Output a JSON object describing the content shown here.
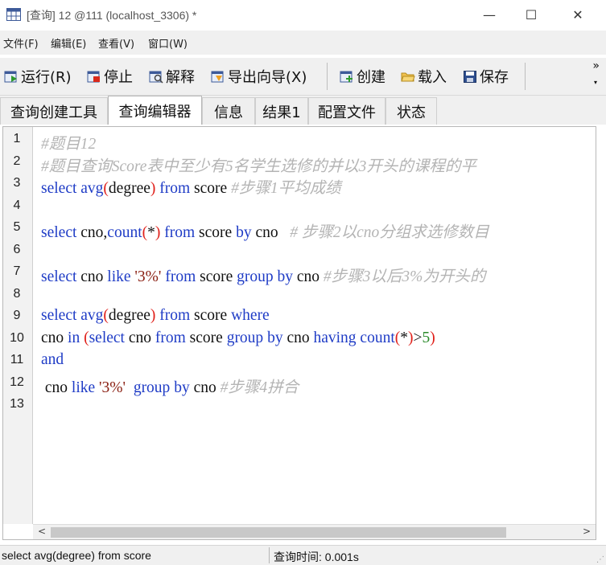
{
  "window": {
    "title": "[查询] 12 @111 (localhost_3306) *",
    "app_icon": "table-grid-icon",
    "controls": {
      "minimize": "—",
      "maximize": "☐",
      "close": "✕"
    }
  },
  "menu": {
    "items": [
      {
        "label": "文件(F)"
      },
      {
        "label": "编辑(E)"
      },
      {
        "label": "查看(V)"
      },
      {
        "label": "窗口(W)"
      }
    ]
  },
  "toolbar": {
    "run": {
      "label": "运行(R)",
      "icon": "run-icon"
    },
    "stop": {
      "label": "停止",
      "icon": "stop-icon"
    },
    "explain": {
      "label": "解释",
      "icon": "explain-icon"
    },
    "export": {
      "label": "导出向导(X)",
      "icon": "export-wizard-icon"
    },
    "create": {
      "label": "创建",
      "icon": "create-icon"
    },
    "load": {
      "label": "载入",
      "icon": "folder-open-icon"
    },
    "save": {
      "label": "保存",
      "icon": "save-icon"
    },
    "more": "»",
    "more_dropdown": "▾"
  },
  "tabs": [
    {
      "label": "查询创建工具"
    },
    {
      "label": "查询编辑器"
    },
    {
      "label": "信息"
    },
    {
      "label": "结果1"
    },
    {
      "label": "配置文件"
    },
    {
      "label": "状态"
    }
  ],
  "active_tab": "查询编辑器",
  "editor": {
    "line_numbers": [
      "1",
      "2",
      "3",
      "4",
      "5",
      "6",
      "7",
      "8",
      "9",
      "10",
      "11",
      "12",
      "13"
    ],
    "lines": [
      [
        {
          "t": "#题目12",
          "c": "cmt"
        }
      ],
      [
        {
          "t": "#题目查询Score表中至少有5名学生选修的并以3开头的课程的平",
          "c": "cmt"
        }
      ],
      [
        {
          "t": "select",
          "c": "kw"
        },
        {
          "t": " "
        },
        {
          "t": "avg",
          "c": "fn"
        },
        {
          "t": "(",
          "c": "par"
        },
        {
          "t": "degree"
        },
        {
          "t": ")",
          "c": "par"
        },
        {
          "t": " "
        },
        {
          "t": "from",
          "c": "kw"
        },
        {
          "t": " score "
        },
        {
          "t": "#步骤1平均成绩",
          "c": "cmt"
        }
      ],
      [],
      [
        {
          "t": "select",
          "c": "kw"
        },
        {
          "t": " cno,"
        },
        {
          "t": "count",
          "c": "fn"
        },
        {
          "t": "(",
          "c": "par"
        },
        {
          "t": "*"
        },
        {
          "t": ")",
          "c": "par"
        },
        {
          "t": " "
        },
        {
          "t": "from",
          "c": "kw"
        },
        {
          "t": " score "
        },
        {
          "t": "by",
          "c": "kw"
        },
        {
          "t": " cno   "
        },
        {
          "t": "# 步骤2以cno分组求选修数目",
          "c": "cmt"
        }
      ],
      [],
      [
        {
          "t": "select",
          "c": "kw"
        },
        {
          "t": " cno "
        },
        {
          "t": "like",
          "c": "kw"
        },
        {
          "t": " "
        },
        {
          "t": "'3%'",
          "c": "str"
        },
        {
          "t": " "
        },
        {
          "t": "from",
          "c": "kw"
        },
        {
          "t": " score "
        },
        {
          "t": "group",
          "c": "kw"
        },
        {
          "t": " "
        },
        {
          "t": "by",
          "c": "kw"
        },
        {
          "t": " cno "
        },
        {
          "t": "#步骤3以后3%为开头的",
          "c": "cmt"
        }
      ],
      [],
      [
        {
          "t": "select",
          "c": "kw"
        },
        {
          "t": " "
        },
        {
          "t": "avg",
          "c": "fn"
        },
        {
          "t": "(",
          "c": "par"
        },
        {
          "t": "degree"
        },
        {
          "t": ")",
          "c": "par"
        },
        {
          "t": " "
        },
        {
          "t": "from",
          "c": "kw"
        },
        {
          "t": " score "
        },
        {
          "t": "where",
          "c": "kw"
        }
      ],
      [
        {
          "t": "cno "
        },
        {
          "t": "in",
          "c": "kw"
        },
        {
          "t": " "
        },
        {
          "t": "(",
          "c": "par"
        },
        {
          "t": "select",
          "c": "kw"
        },
        {
          "t": " cno "
        },
        {
          "t": "from",
          "c": "kw"
        },
        {
          "t": " score "
        },
        {
          "t": "group",
          "c": "kw"
        },
        {
          "t": " "
        },
        {
          "t": "by",
          "c": "kw"
        },
        {
          "t": " cno "
        },
        {
          "t": "having",
          "c": "kw"
        },
        {
          "t": " "
        },
        {
          "t": "count",
          "c": "fn"
        },
        {
          "t": "(",
          "c": "par"
        },
        {
          "t": "*"
        },
        {
          "t": ")",
          "c": "par"
        },
        {
          "t": ">"
        },
        {
          "t": "5",
          "c": "num"
        },
        {
          "t": ")",
          "c": "par"
        }
      ],
      [
        {
          "t": "and",
          "c": "kw"
        }
      ],
      [
        {
          "t": " cno "
        },
        {
          "t": "like",
          "c": "kw"
        },
        {
          "t": " "
        },
        {
          "t": "'3%'",
          "c": "str"
        },
        {
          "t": "  "
        },
        {
          "t": "group",
          "c": "kw"
        },
        {
          "t": " "
        },
        {
          "t": "by",
          "c": "kw"
        },
        {
          "t": " cno "
        },
        {
          "t": "#步骤4拼合",
          "c": "cmt"
        }
      ],
      []
    ],
    "colors": {
      "keyword": "#1f3cc6",
      "comment": "#b4b4b4",
      "paren": "#e0201a",
      "string": "#8a1f12",
      "number": "#2a8a2a"
    }
  },
  "scrollbar": {
    "left_arrow": "<",
    "right_arrow": ">"
  },
  "status": {
    "query": "select avg(degree) from score",
    "time": "查询时间: 0.001s"
  }
}
